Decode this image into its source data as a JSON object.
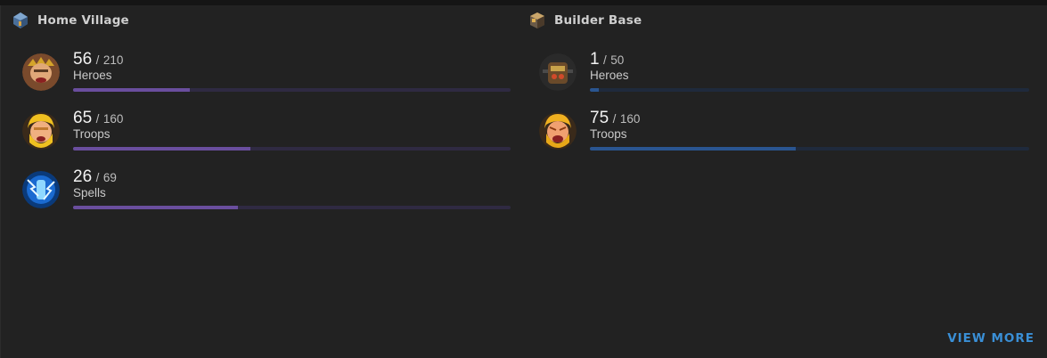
{
  "home_village": {
    "title": "Home Village",
    "icon": "home-village-icon",
    "stats": [
      {
        "count": "56",
        "separator": "/",
        "total": "210",
        "label": "Heroes",
        "progress": 0.267,
        "icon": "barbarian-king-icon"
      },
      {
        "count": "65",
        "separator": "/",
        "total": "160",
        "label": "Troops",
        "progress": 0.406,
        "icon": "barbarian-icon"
      },
      {
        "count": "26",
        "separator": "/",
        "total": "69",
        "label": "Spells",
        "progress": 0.377,
        "icon": "lightning-spell-icon"
      }
    ]
  },
  "builder_base": {
    "title": "Builder Base",
    "icon": "builder-base-icon",
    "stats": [
      {
        "count": "1",
        "separator": "/",
        "total": "50",
        "label": "Heroes",
        "progress": 0.02,
        "icon": "battle-machine-icon"
      },
      {
        "count": "75",
        "separator": "/",
        "total": "160",
        "label": "Troops",
        "progress": 0.469,
        "icon": "raged-barbarian-icon"
      }
    ]
  },
  "footer": {
    "view_more_label": "VIEW MORE"
  },
  "colors": {
    "home_bar_fill": "#6a4e9e",
    "builder_bar_fill": "#2a5590",
    "link_accent": "#3a8fd6"
  }
}
